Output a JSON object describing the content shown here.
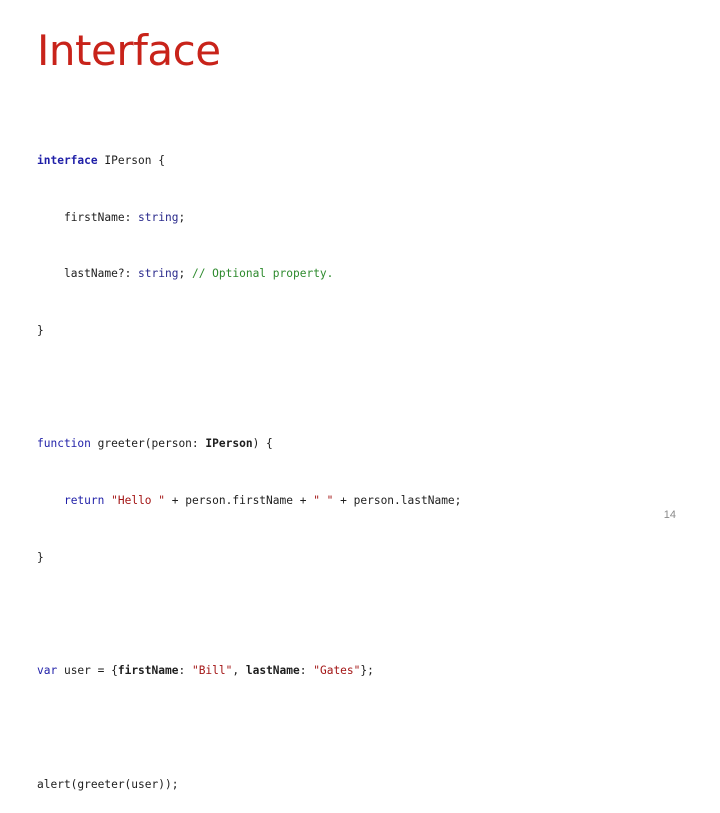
{
  "slide": {
    "title": "Interface",
    "page_number": "14"
  },
  "code": {
    "l1": {
      "kw": "interface",
      "rest": " IPerson {"
    },
    "l2": {
      "indent": "    ",
      "name": "firstName: ",
      "type": "string",
      "end": ";"
    },
    "l3": {
      "indent": "    ",
      "name": "lastName?: ",
      "type": "string",
      "end": "; ",
      "comment": "// Optional property."
    },
    "l4": {
      "text": "}"
    },
    "l6": {
      "kw": "function",
      "a": " greeter(person: ",
      "type": "IPerson",
      "b": ") {"
    },
    "l7": {
      "indent": "    ",
      "kw": "return",
      "sp": " ",
      "s1": "\"Hello \"",
      "a": " + person.firstName + ",
      "s2": "\" \"",
      "b": " + person.lastName;"
    },
    "l8": {
      "text": "}"
    },
    "l10": {
      "kw": "var",
      "a": " user = {",
      "k1": "firstName",
      "c1": ": ",
      "s1": "\"Bill\"",
      "c2": ", ",
      "k2": "lastName",
      "c3": ": ",
      "s2": "\"Gates\"",
      "end": "};"
    },
    "l12": {
      "text": "alert(greeter(user));"
    }
  },
  "colors": {
    "title": "#c8231a",
    "keyword": "#1f1fa8",
    "string": "#a31515",
    "comment": "#2d8a2d"
  }
}
